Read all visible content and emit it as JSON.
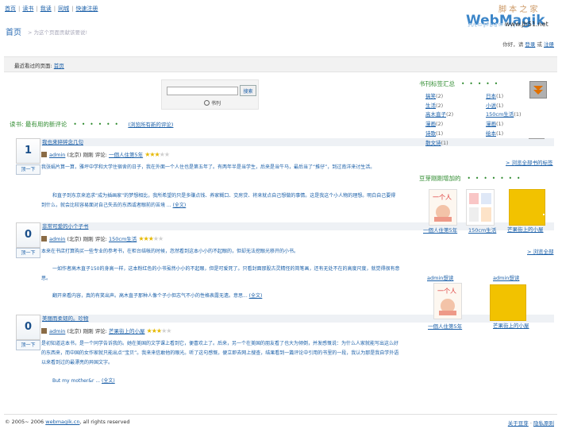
{
  "nav": {
    "items": [
      "首页",
      "读书",
      "我读",
      "同城",
      "快速注册"
    ]
  },
  "home_link": "首页",
  "slogan": "> 为这个页面贡献该要说!",
  "logo": {
    "text": "WebMagik",
    "reflection": "WebMagik",
    "watermark_chars": "脚 本 之 家",
    "watermark_url": "www.Jb51.net"
  },
  "user_line": {
    "prefix": "你好，请",
    "login": "登录",
    "or": "或",
    "register": "注册"
  },
  "recent": {
    "label": "最近看过的页面:",
    "link": "首页"
  },
  "search": {
    "value": "",
    "button": "搜索",
    "radio_label": "书刊"
  },
  "reviews_section": {
    "title": "读书: 最有用的新评论",
    "all_link": "(浏览所有新的评论)"
  },
  "reviews": [
    {
      "count": "1",
      "up": "顶一下",
      "title": "我也来碎碎念几句",
      "author": "admin",
      "city": "(北京)",
      "time": "刚刚",
      "review_label": "评论:",
      "book": "一個人住第5年",
      "stars": 3,
      "paras": [
        "我张娟片算一算，雅坪中学和大学住宿舍的日子，我在外面一个人住也是第五年了。有两年半是当学生，后来是当牛马，最后当了“推仔”，到过南洋来讨生活。",
        "和直子到东京来追求“成为插画家”的梦想相比，我所希望的只是多赚点钱、养家糊口、交房贷、将来就点自己想做的事情。这是我这个小人物的理想。明白自己要得到什么，就会比较容易面对自己失去的东西或者眼前的苦境 ..."
      ],
      "more": "(全文)"
    },
    {
      "count": "0",
      "up": "顶一下",
      "title": "非常可爱的小个子书",
      "author": "admin",
      "city": "(北京)",
      "time": "刚刚",
      "review_label": "评论:",
      "book": "150cm生活",
      "stars": 3,
      "paras": [
        "本来在书店打算购买一些专业的参考书，在柜台结帐的时候，忽然看到这本小小的不起眼的，但却无法挖眼光移开的小书。",
        "一如作者高木直子150的身高一样，这本粉红色的小书虽然小小的不起眼，但是可爱死了。只看封面那股古灵精怪的简笔画，还有无处不在的高度尺度，就觉得很有意思。",
        "翻开来看内容，真的有笑出声。高木直子那种人像个子小但志气不小的性格表露无遗。意思..."
      ],
      "more": "(全文)"
    },
    {
      "count": "0",
      "up": "顶一下",
      "title": "美丽而柔韧的。珍物",
      "author": "admin",
      "city": "(北京)",
      "time": "刚刚",
      "review_label": "评论:",
      "book": "芒果街上的小屋",
      "stars": 3,
      "paras": [
        "是初知道这本书，是一个同学告诉我的。她在美国的文学课上看到它，便喜欢上了。后来，另一个在美国的朋友看了也大为倾倒，并发感慨说：为什么人家就能写出这么好的东西来，而中国的女作家就只能出点“宝贝”。我来来信敢他的眼光。听了这句感慨，便立即去网上搜查，结果看到一篇评论中引用的书里的一段，我认为那是我自学外语以来看到过的最漂亮的异国文字。",
        "But my mother&r ..."
      ],
      "more": "(全文)"
    }
  ],
  "tags_section": {
    "title": "书刊标签汇总",
    "left": [
      {
        "name": "搞笑",
        "count": "(2)"
      },
      {
        "name": "生活",
        "count": "(2)"
      },
      {
        "name": "高木直子",
        "count": "(2)"
      },
      {
        "name": "漫画",
        "count": "(2)"
      },
      {
        "name": "诗歌",
        "count": "(1)"
      },
      {
        "name": "散文诗",
        "count": "(1)"
      }
    ],
    "right": [
      {
        "name": "日本",
        "count": "(1)"
      },
      {
        "name": "小说",
        "count": "(1)"
      },
      {
        "name": "150cm生活",
        "count": "(1)"
      },
      {
        "name": "漫画",
        "count": "(1)"
      },
      {
        "name": "绘本",
        "count": "(1)"
      }
    ],
    "all_link": "> 浏览全部书的标签"
  },
  "new_section": {
    "title": "豆芽刚刚增加的",
    "books": [
      {
        "title": "一個人住第5年"
      },
      {
        "title": "150cm生活"
      },
      {
        "title": "芒果街上的小屋"
      }
    ],
    "all_link": "> 浏览全部"
  },
  "wish_section": {
    "items": [
      {
        "user": "admin想读",
        "book": "一個人住第5年"
      },
      {
        "user": "admin想读",
        "book": "芒果街上的小屋"
      }
    ]
  },
  "footer": {
    "copyright": "© 2005~ 2006",
    "site": "webmagik.cn",
    "rights": ", all rights reserved",
    "about": "关于豆芽",
    "sep": "·",
    "privacy": "隐私原则"
  },
  "colors": {
    "link": "#1a5fa8",
    "section_title": "#2e8b2e",
    "star": "#e6b800",
    "logo_blue": "#3b85c8",
    "yellow_cover": "#f2c200"
  }
}
